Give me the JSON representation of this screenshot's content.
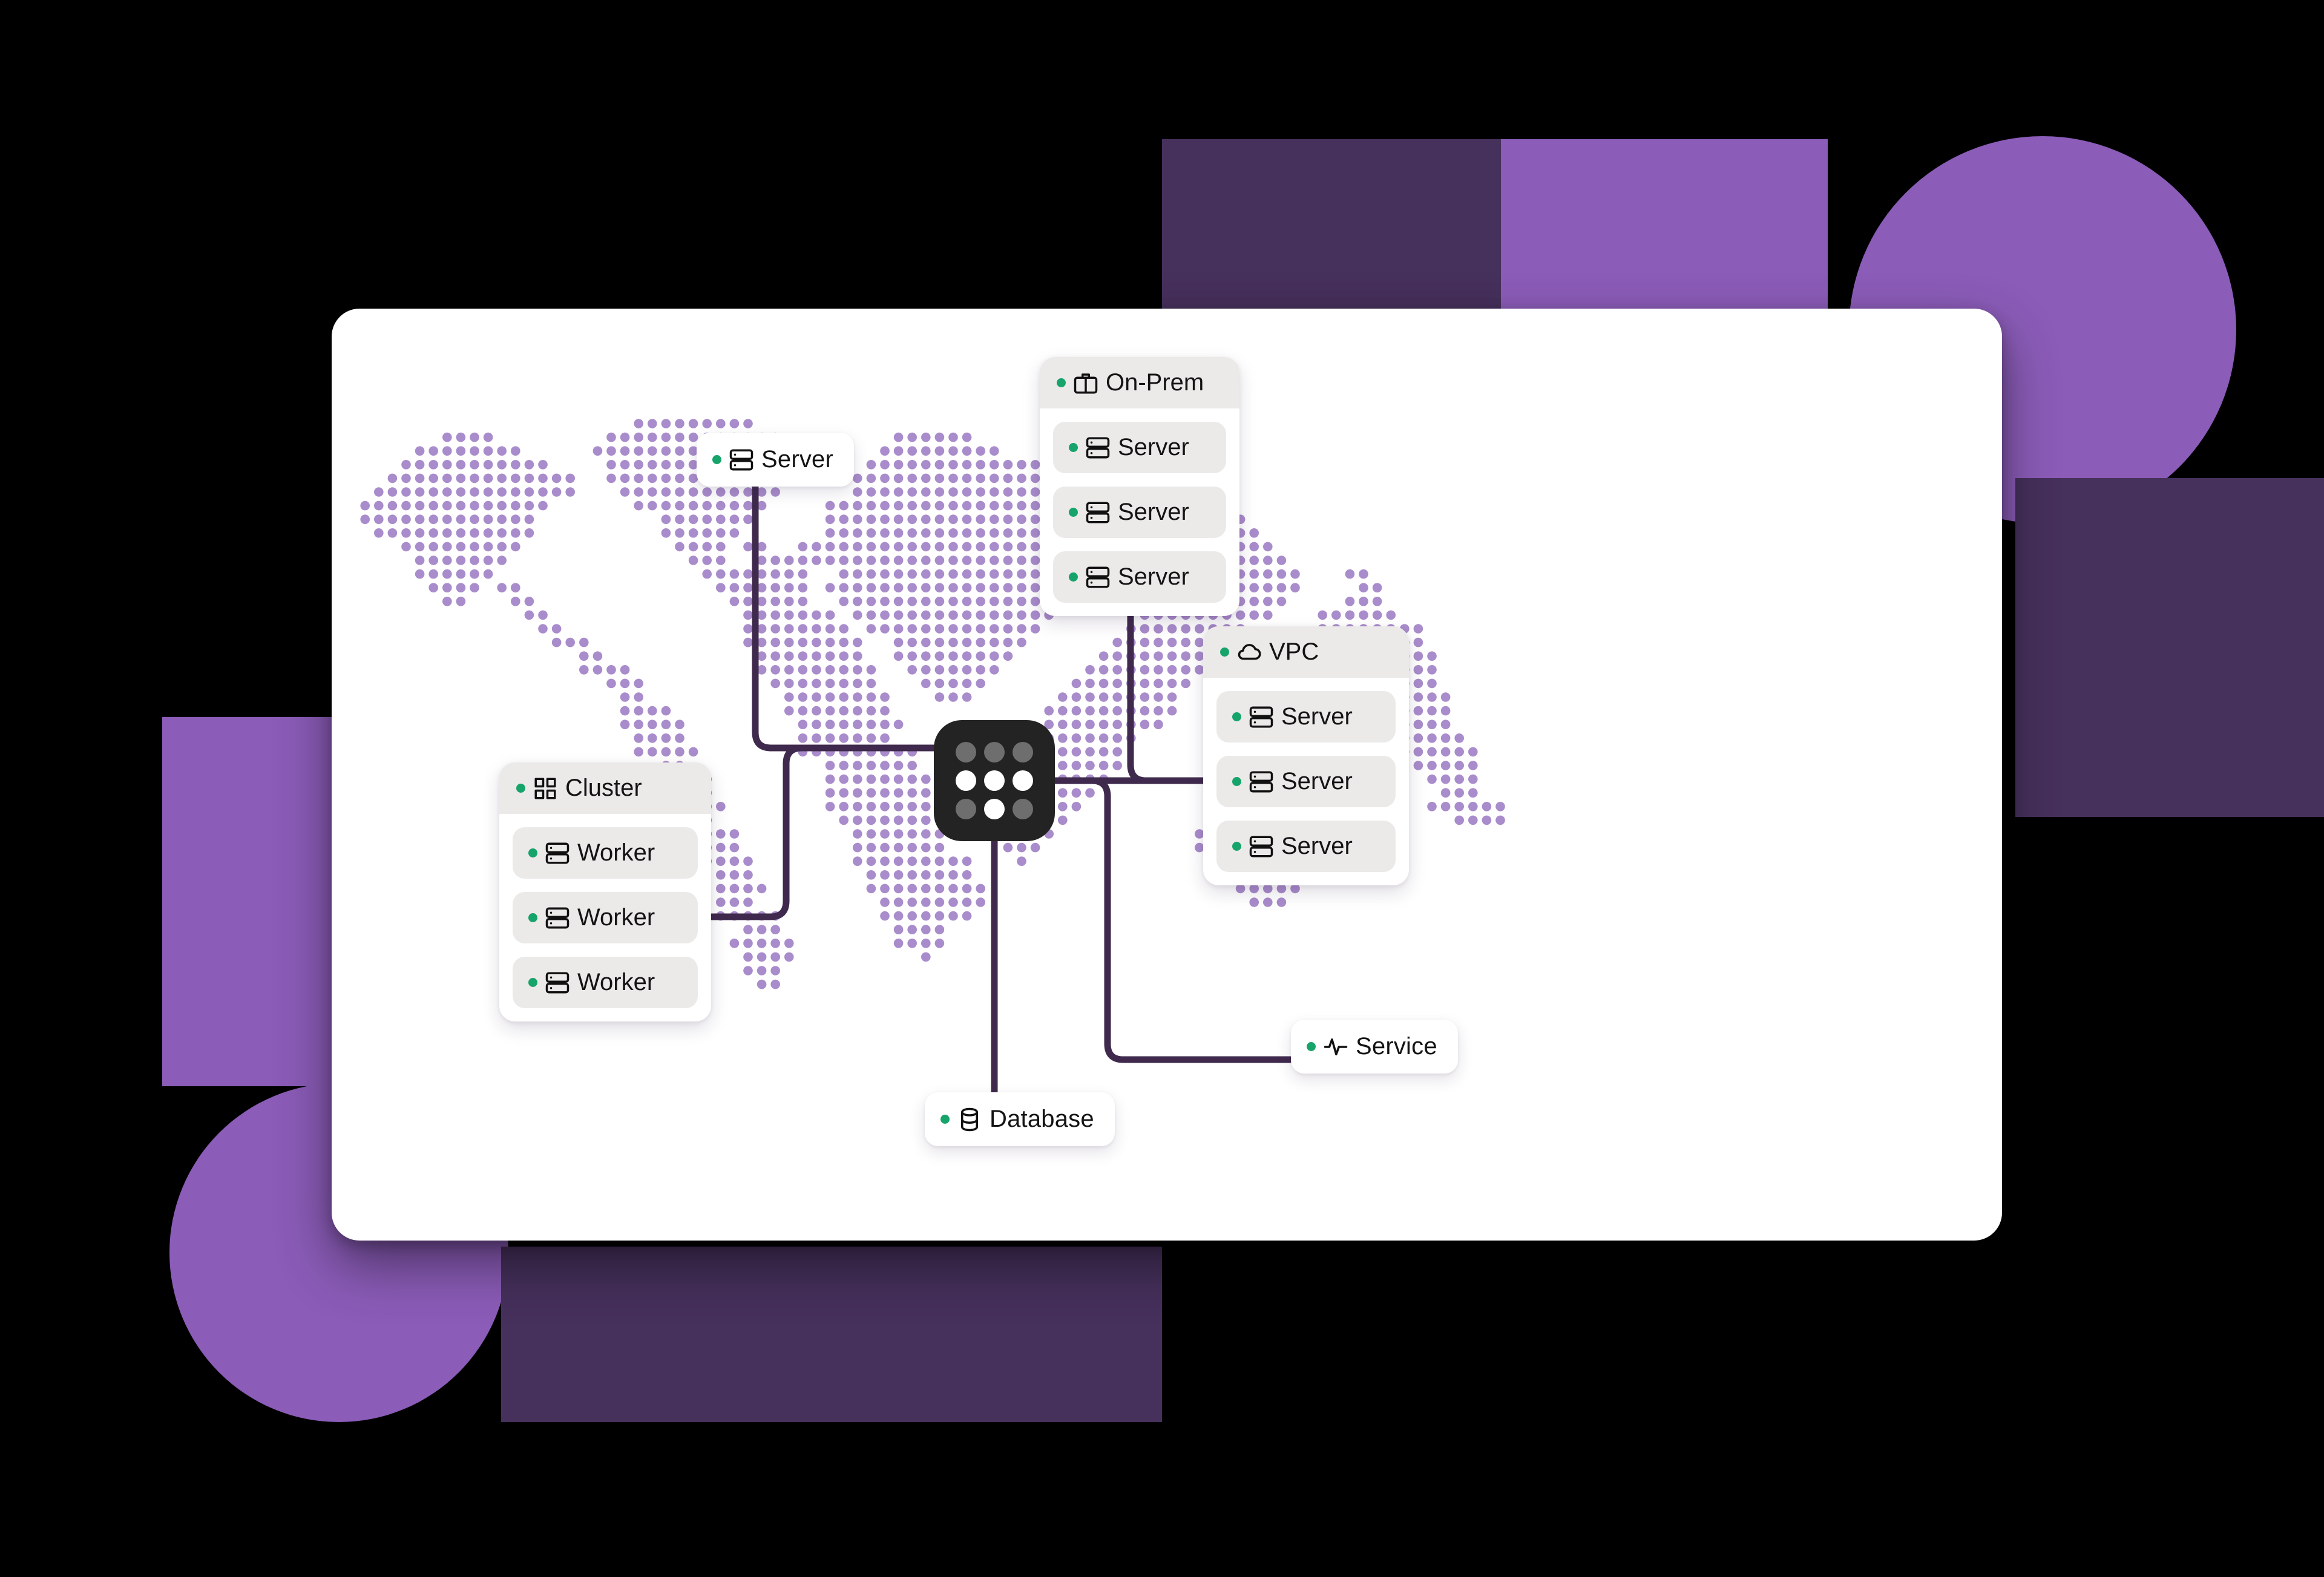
{
  "theme": {
    "panel_bg": "#ffffff",
    "accent_purple": "#8b5cb8",
    "accent_purple_dark": "#46305c",
    "map_dot": "#a98ccb",
    "link_line": "#3f2a4d",
    "status_green": "#16a46b",
    "hub_bg": "#232323",
    "chip_bg": "#ece9e9"
  },
  "diagram": {
    "hub": {
      "name": "network-hub",
      "dots": [
        0,
        0,
        0,
        1,
        1,
        1,
        0,
        1,
        0
      ]
    },
    "groups": [
      {
        "id": "onprem",
        "title": "On-Prem",
        "icon": "briefcase-icon",
        "status": "online",
        "children": [
          {
            "label": "Server",
            "icon": "server-icon",
            "status": "online"
          },
          {
            "label": "Server",
            "icon": "server-icon",
            "status": "online"
          },
          {
            "label": "Server",
            "icon": "server-icon",
            "status": "online"
          }
        ]
      },
      {
        "id": "cluster",
        "title": "Cluster",
        "icon": "grid-icon",
        "status": "online",
        "children": [
          {
            "label": "Worker",
            "icon": "server-icon",
            "status": "online"
          },
          {
            "label": "Worker",
            "icon": "server-icon",
            "status": "online"
          },
          {
            "label": "Worker",
            "icon": "server-icon",
            "status": "online"
          }
        ]
      },
      {
        "id": "vpc",
        "title": "VPC",
        "icon": "cloud-icon",
        "status": "online",
        "children": [
          {
            "label": "Server",
            "icon": "server-icon",
            "status": "online"
          },
          {
            "label": "Server",
            "icon": "server-icon",
            "status": "online"
          },
          {
            "label": "Server",
            "icon": "server-icon",
            "status": "online"
          }
        ]
      }
    ],
    "nodes": [
      {
        "id": "server-top",
        "label": "Server",
        "icon": "server-icon",
        "status": "online"
      },
      {
        "id": "database",
        "label": "Database",
        "icon": "database-icon",
        "status": "online"
      },
      {
        "id": "service",
        "label": "Service",
        "icon": "activity-icon",
        "status": "online"
      }
    ],
    "connections": [
      {
        "from": "server-top",
        "to": "hub"
      },
      {
        "from": "cluster",
        "to": "hub"
      },
      {
        "from": "onprem",
        "to": "hub"
      },
      {
        "from": "vpc",
        "to": "hub"
      },
      {
        "from": "database",
        "to": "hub"
      },
      {
        "from": "service",
        "to": "hub"
      }
    ]
  }
}
